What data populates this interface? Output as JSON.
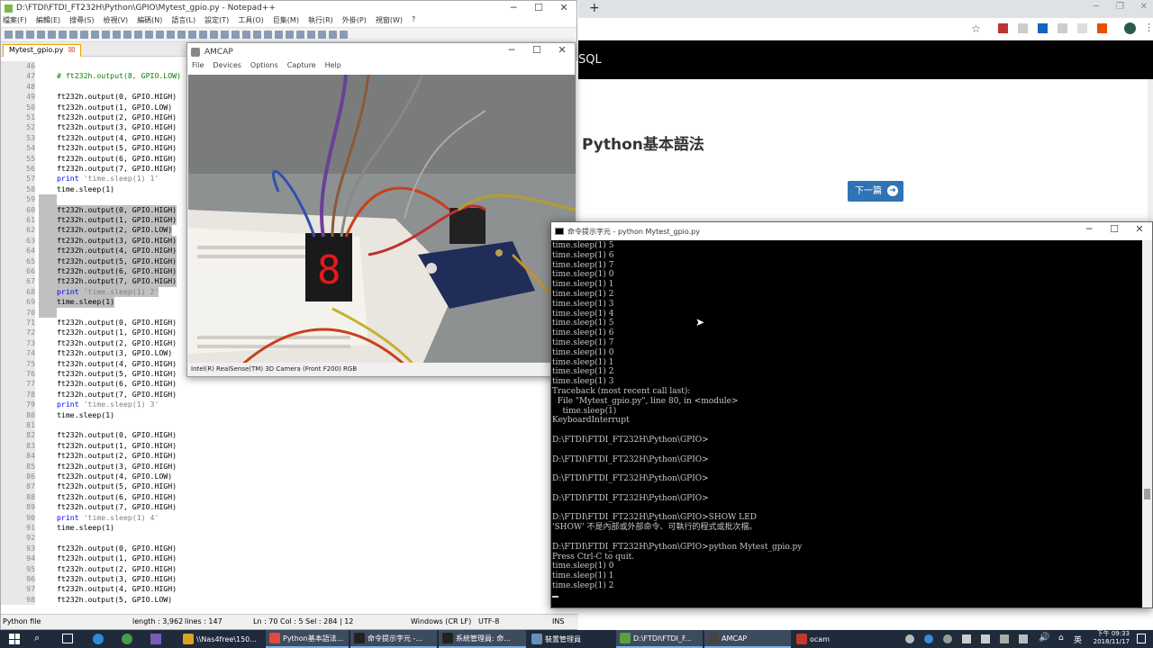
{
  "chrome": {
    "heading": "Python基本語法",
    "next_button": "下一篇",
    "header_text": "SQL",
    "new_tab": "+"
  },
  "notepad": {
    "title": "D:\\FTDI\\FTDI_FT232H\\Python\\GPIO\\Mytest_gpio.py - Notepad++",
    "menu": [
      "檔案(F)",
      "編輯(E)",
      "搜尋(S)",
      "檢視(V)",
      "編碼(N)",
      "語言(L)",
      "設定(T)",
      "工具(O)",
      "巨集(M)",
      "執行(R)",
      "外掛(P)",
      "視窗(W)",
      "?"
    ],
    "tab": "Mytest_gpio.py",
    "status": {
      "filetype": "Python file",
      "length": "length : 3,962",
      "lines": "lines : 147",
      "pos": "Ln : 70   Col : 5   Sel : 284 | 12",
      "eol": "Windows (CR LF)",
      "enc": "UTF-8",
      "ins": "INS"
    },
    "lines": [
      {
        "n": "46",
        "t": ""
      },
      {
        "n": "47",
        "t": "# ft232h.output(8, GPIO.LOW)",
        "c": "cmt"
      },
      {
        "n": "48",
        "t": ""
      },
      {
        "n": "49",
        "t": "ft232h.output(0, GPIO.HIGH)"
      },
      {
        "n": "50",
        "t": "ft232h.output(1, GPIO.LOW)"
      },
      {
        "n": "51",
        "t": "ft232h.output(2, GPIO.HIGH)"
      },
      {
        "n": "52",
        "t": "ft232h.output(3, GPIO.HIGH)"
      },
      {
        "n": "53",
        "t": "ft232h.output(4, GPIO.HIGH)"
      },
      {
        "n": "54",
        "t": "ft232h.output(5, GPIO.HIGH)"
      },
      {
        "n": "55",
        "t": "ft232h.output(6, GPIO.HIGH)"
      },
      {
        "n": "56",
        "t": "ft232h.output(7, GPIO.HIGH)"
      },
      {
        "n": "57",
        "k": "print",
        "s": " 'time.sleep(1) 1'"
      },
      {
        "n": "58",
        "t": "time.sleep(1)"
      },
      {
        "n": "59",
        "t": "",
        "sel": true
      },
      {
        "n": "60",
        "t": "ft232h.output(0, GPIO.HIGH)",
        "sel": true
      },
      {
        "n": "61",
        "t": "ft232h.output(1, GPIO.HIGH)",
        "sel": true
      },
      {
        "n": "62",
        "t": "ft232h.output(2, GPIO.LOW)",
        "sel": true
      },
      {
        "n": "63",
        "t": "ft232h.output(3, GPIO.HIGH)",
        "sel": true
      },
      {
        "n": "64",
        "t": "ft232h.output(4, GPIO.HIGH)",
        "sel": true
      },
      {
        "n": "65",
        "t": "ft232h.output(5, GPIO.HIGH)",
        "sel": true
      },
      {
        "n": "66",
        "t": "ft232h.output(6, GPIO.HIGH)",
        "sel": true
      },
      {
        "n": "67",
        "t": "ft232h.output(7, GPIO.HIGH)",
        "sel": true
      },
      {
        "n": "68",
        "k": "print",
        "s": " 'time.sleep(1) 2'",
        "sel": true
      },
      {
        "n": "69",
        "t": "time.sleep(1)",
        "sel": true
      },
      {
        "n": "70",
        "t": "",
        "sel": true
      },
      {
        "n": "71",
        "t": "ft232h.output(0, GPIO.HIGH)"
      },
      {
        "n": "72",
        "t": "ft232h.output(1, GPIO.HIGH)"
      },
      {
        "n": "73",
        "t": "ft232h.output(2, GPIO.HIGH)"
      },
      {
        "n": "74",
        "t": "ft232h.output(3, GPIO.LOW)"
      },
      {
        "n": "75",
        "t": "ft232h.output(4, GPIO.HIGH)"
      },
      {
        "n": "76",
        "t": "ft232h.output(5, GPIO.HIGH)"
      },
      {
        "n": "77",
        "t": "ft232h.output(6, GPIO.HIGH)"
      },
      {
        "n": "78",
        "t": "ft232h.output(7, GPIO.HIGH)"
      },
      {
        "n": "79",
        "k": "print",
        "s": " 'time.sleep(1) 3'"
      },
      {
        "n": "80",
        "t": "time.sleep(1)"
      },
      {
        "n": "81",
        "t": ""
      },
      {
        "n": "82",
        "t": "ft232h.output(0, GPIO.HIGH)"
      },
      {
        "n": "83",
        "t": "ft232h.output(1, GPIO.HIGH)"
      },
      {
        "n": "84",
        "t": "ft232h.output(2, GPIO.HIGH)"
      },
      {
        "n": "85",
        "t": "ft232h.output(3, GPIO.HIGH)"
      },
      {
        "n": "86",
        "t": "ft232h.output(4, GPIO.LOW)"
      },
      {
        "n": "87",
        "t": "ft232h.output(5, GPIO.HIGH)"
      },
      {
        "n": "88",
        "t": "ft232h.output(6, GPIO.HIGH)"
      },
      {
        "n": "89",
        "t": "ft232h.output(7, GPIO.HIGH)"
      },
      {
        "n": "90",
        "k": "print",
        "s": " 'time.sleep(1) 4'"
      },
      {
        "n": "91",
        "t": "time.sleep(1)"
      },
      {
        "n": "92",
        "t": ""
      },
      {
        "n": "93",
        "t": "ft232h.output(0, GPIO.HIGH)"
      },
      {
        "n": "94",
        "t": "ft232h.output(1, GPIO.HIGH)"
      },
      {
        "n": "95",
        "t": "ft232h.output(2, GPIO.HIGH)"
      },
      {
        "n": "96",
        "t": "ft232h.output(3, GPIO.HIGH)"
      },
      {
        "n": "97",
        "t": "ft232h.output(4, GPIO.HIGH)"
      },
      {
        "n": "98",
        "t": "ft232h.output(5, GPIO.LOW)"
      }
    ]
  },
  "amcap": {
    "title": "AMCAP",
    "menu": [
      "File",
      "Devices",
      "Options",
      "Capture",
      "Help"
    ],
    "status": "Intel(R) RealSense(TM) 3D Camera (Front F200) RGB",
    "led_digit": "8"
  },
  "cmd": {
    "title": "命令提示字元 - python  Mytest_gpio.py",
    "lines": [
      "time.sleep(1) 5",
      "time.sleep(1) 6",
      "time.sleep(1) 7",
      "time.sleep(1) 0",
      "time.sleep(1) 1",
      "time.sleep(1) 2",
      "time.sleep(1) 3",
      "time.sleep(1) 4",
      "time.sleep(1) 5",
      "time.sleep(1) 6",
      "time.sleep(1) 7",
      "time.sleep(1) 0",
      "time.sleep(1) 1",
      "time.sleep(1) 2",
      "time.sleep(1) 3",
      "Traceback (most recent call last):",
      "  File \"Mytest_gpio.py\", line 80, in <module>",
      "    time.sleep(1)",
      "KeyboardInterrupt",
      "",
      "D:\\FTDI\\FTDI_FT232H\\Python\\GPIO>",
      "",
      "D:\\FTDI\\FTDI_FT232H\\Python\\GPIO>",
      "",
      "D:\\FTDI\\FTDI_FT232H\\Python\\GPIO>",
      "",
      "D:\\FTDI\\FTDI_FT232H\\Python\\GPIO>",
      "",
      "D:\\FTDI\\FTDI_FT232H\\Python\\GPIO>SHOW LED",
      "'SHOW' 不是內部或外部命令、可執行的程式或批次檔。",
      "",
      "D:\\FTDI\\FTDI_FT232H\\Python\\GPIO>python Mytest_gpio.py",
      "Press Ctrl-C to quit.",
      "time.sleep(1) 0",
      "time.sleep(1) 1",
      "time.sleep(1) 2"
    ]
  },
  "taskbar": {
    "items": [
      {
        "label": "\\\\Nas4free\\150..."
      },
      {
        "label": "Python基本語法..."
      },
      {
        "label": "命令提示字元 -..."
      },
      {
        "label": "系統管理員: 命..."
      },
      {
        "label": "裝置管理員"
      },
      {
        "label": "D:\\FTDI\\FTDI_F..."
      },
      {
        "label": "AMCAP"
      },
      {
        "label": "ocam"
      }
    ],
    "ime": "英",
    "time": "下午 09:33",
    "date": "2018/11/17"
  }
}
